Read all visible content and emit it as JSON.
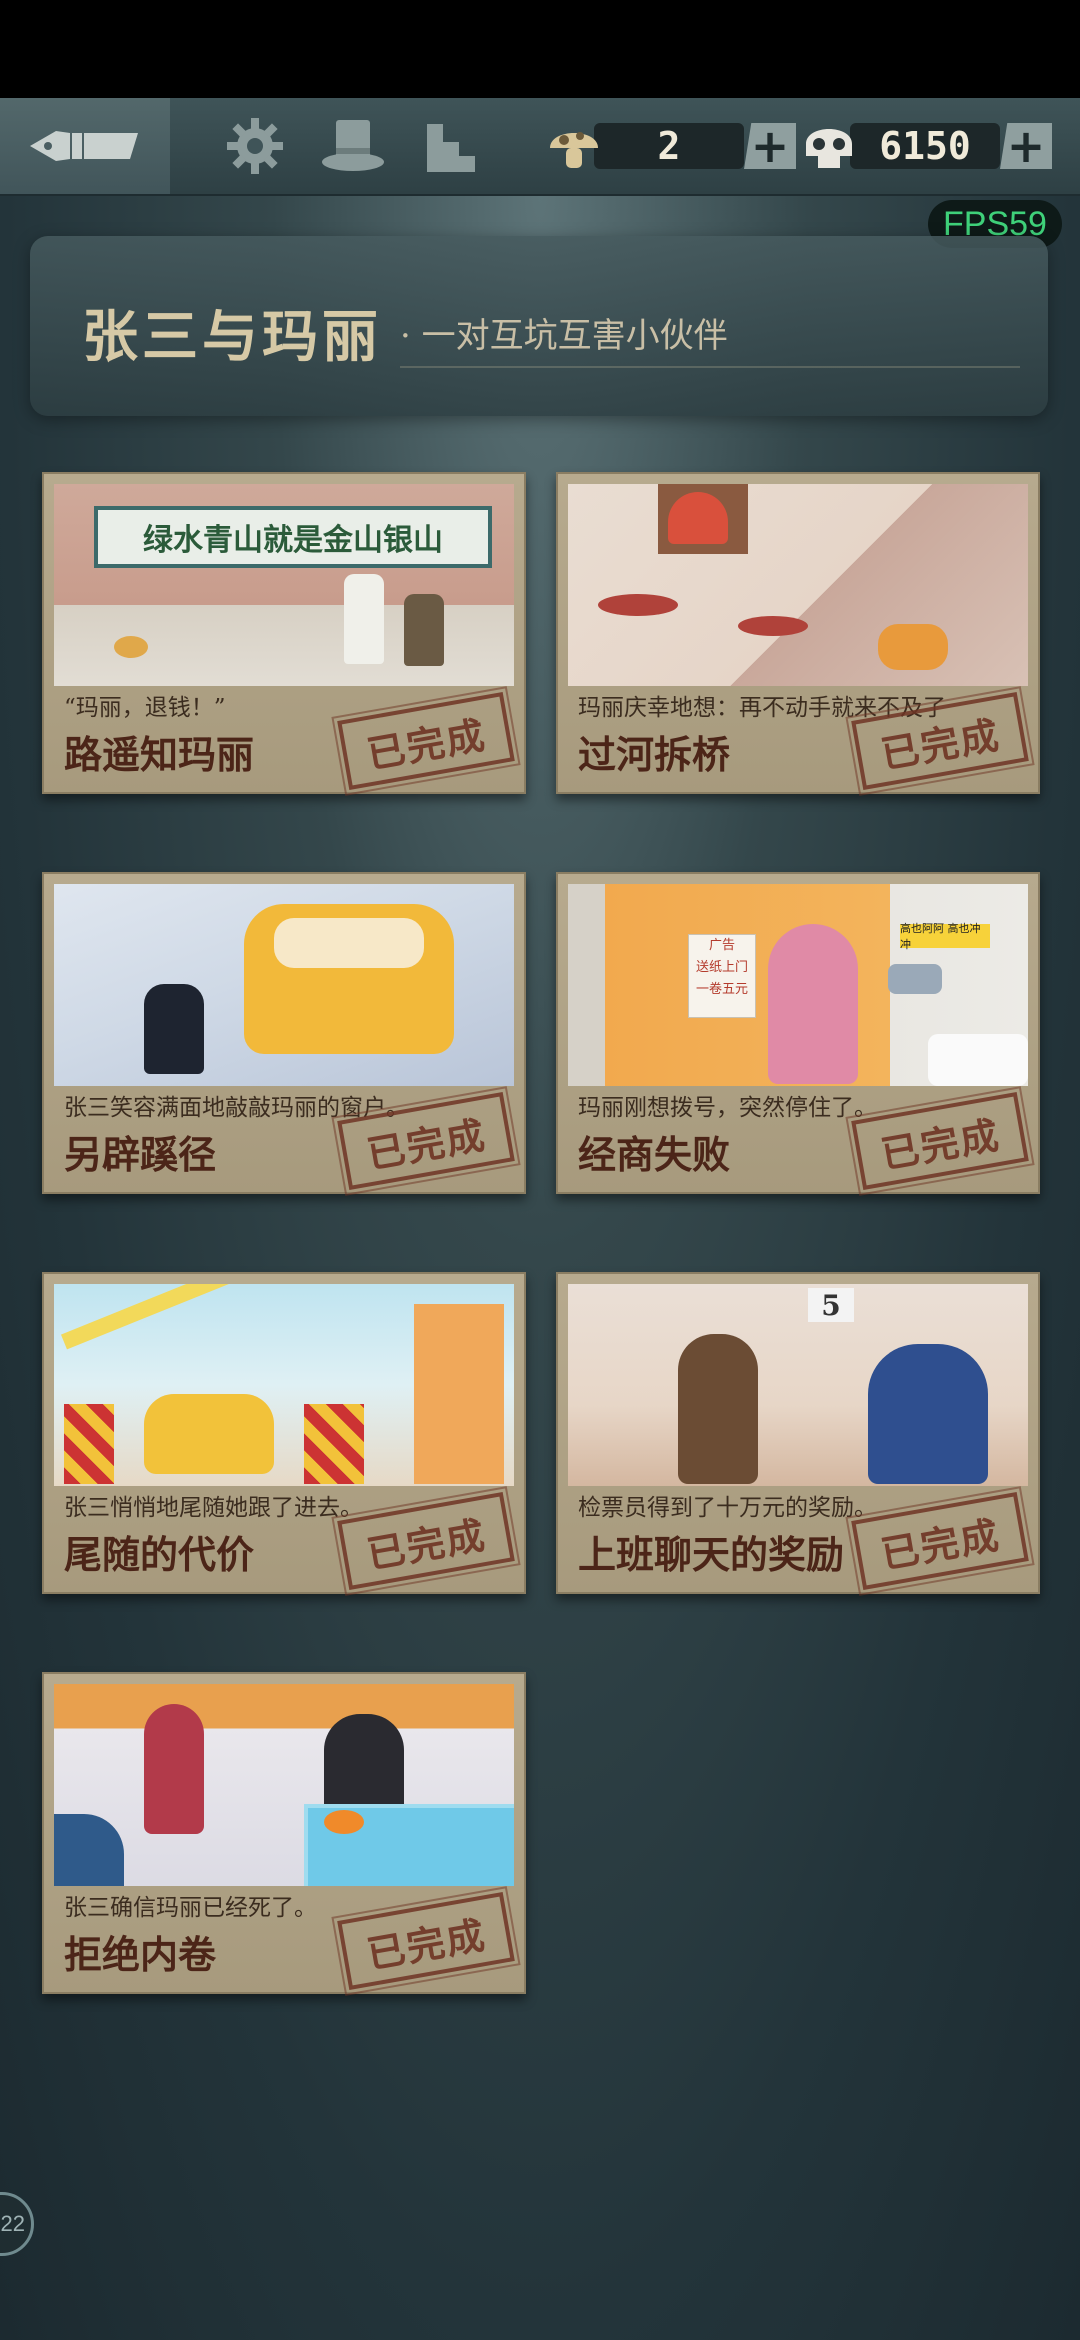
{
  "resources": {
    "mushroom_count": "2",
    "skull_count": "6150"
  },
  "fps": "FPS59",
  "header": {
    "title": "张三与玛丽",
    "subtitle": "· 一对互坑互害小伙伴"
  },
  "cards": [
    {
      "caption": "“玛丽，退钱！”",
      "title": "路遥知玛丽",
      "status": "已完成",
      "banner_text": "绿水青山就是金山银山"
    },
    {
      "caption": "玛丽庆幸地想：再不动手就来不及了",
      "title": "过河拆桥",
      "status": "已完成"
    },
    {
      "caption": "张三笑容满面地敲敲玛丽的窗户。",
      "title": "另辟蹊径",
      "status": "已完成"
    },
    {
      "caption": "玛丽刚想拨号，突然停住了。",
      "title": "经商失败",
      "status": "已完成",
      "poster_text": [
        "广告",
        "送纸上门",
        "一卷五元"
      ],
      "sign_text": "高也阿阿 高也冲冲"
    },
    {
      "caption": "张三悄悄地尾随她跟了进去。",
      "title": "尾随的代价",
      "status": "已完成"
    },
    {
      "caption": "检票员得到了十万元的奖励。",
      "title": "上班聊天的奖励",
      "status": "已完成",
      "sign_number": "5"
    },
    {
      "caption": "张三确信玛丽已经死了。",
      "title": "拒绝内卷",
      "status": "已完成"
    }
  ],
  "avatar_text": "22",
  "colors": {
    "card_bg": "#b3a78b",
    "stamp": "#6e3424",
    "fps_green": "#3fd17a"
  }
}
